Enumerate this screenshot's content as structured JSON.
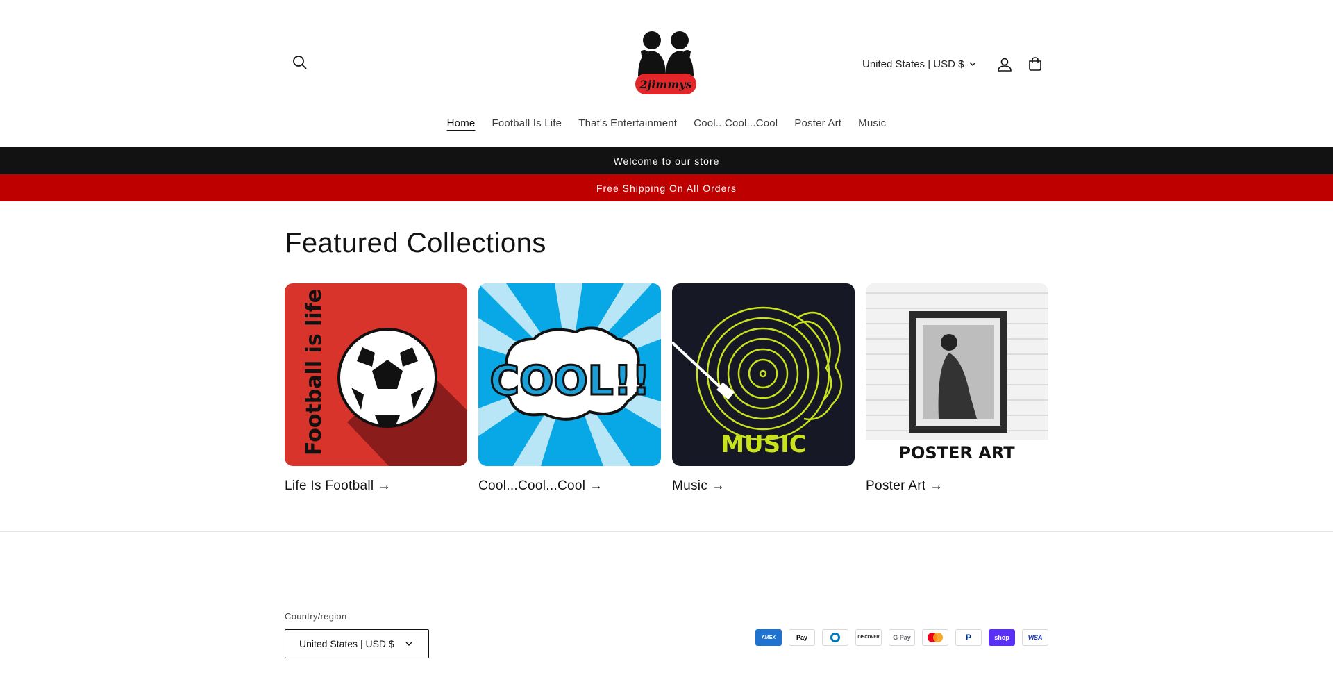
{
  "header": {
    "logo_text": "2jimmys",
    "country_selector": "United States | USD $"
  },
  "nav": {
    "items": [
      {
        "label": "Home",
        "active": true
      },
      {
        "label": "Football Is Life"
      },
      {
        "label": "That's Entertainment"
      },
      {
        "label": "Cool...Cool...Cool"
      },
      {
        "label": "Poster Art"
      },
      {
        "label": "Music"
      }
    ]
  },
  "announcements": {
    "welcome": "Welcome to our store",
    "shipping": "Free Shipping On All Orders"
  },
  "featured": {
    "title": "Featured Collections",
    "collections": [
      {
        "title": "Life Is Football →",
        "image_text": "Football is life"
      },
      {
        "title": "Cool...Cool...Cool →",
        "image_text": "COOL!!"
      },
      {
        "title": "Music →",
        "image_text": "MUSIC"
      },
      {
        "title": "Poster Art →",
        "image_text": "POSTER ART"
      }
    ]
  },
  "footer": {
    "country_label": "Country/region",
    "country_value": "United States | USD $",
    "payment_methods": [
      {
        "name": "AMEX",
        "color": "#1f72cd"
      },
      {
        "name": "Pay",
        "color": "#000000"
      },
      {
        "name": "Diners",
        "color": "#0079be"
      },
      {
        "name": "DISCOVER",
        "color": "#f47216"
      },
      {
        "name": "G Pay",
        "color": "#5f6368"
      },
      {
        "name": "Mastercard",
        "color": "#eb001b"
      },
      {
        "name": "P",
        "color": "#003087"
      },
      {
        "name": "shop",
        "color": "#5a31f4"
      },
      {
        "name": "VISA",
        "color": "#1434cb"
      }
    ]
  },
  "colors": {
    "announcement_black": "#121212",
    "announcement_red": "#bf0000",
    "text": "#121212"
  }
}
